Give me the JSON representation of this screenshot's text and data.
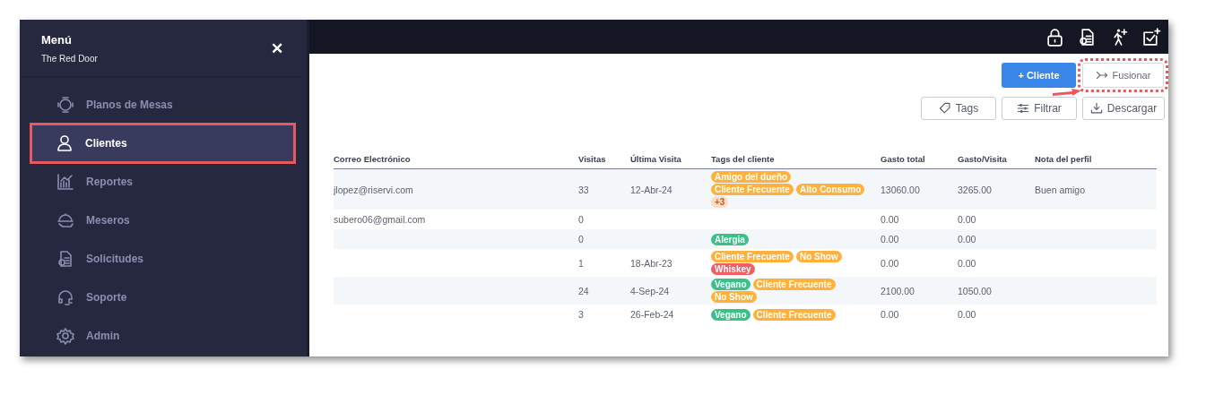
{
  "sidebar": {
    "title": "Menú",
    "subtitle": "The Red Door",
    "close_label": "✕",
    "items": [
      {
        "label": "Planos de Mesas",
        "kind": "table",
        "selected": false
      },
      {
        "label": "Clientes",
        "kind": "person",
        "selected": true
      },
      {
        "label": "Reportes",
        "kind": "chart",
        "selected": false
      },
      {
        "label": "Meseros",
        "kind": "waiter",
        "selected": false
      },
      {
        "label": "Solicitudes",
        "kind": "document",
        "selected": false
      },
      {
        "label": "Soporte",
        "kind": "headset",
        "selected": false
      },
      {
        "label": "Admin",
        "kind": "gear",
        "selected": false
      }
    ]
  },
  "topbar": {
    "icons": [
      {
        "kind": "lock"
      },
      {
        "kind": "document"
      },
      {
        "kind": "walker"
      },
      {
        "kind": "check"
      }
    ]
  },
  "actions": [
    {
      "label": "+ Cliente",
      "kind": "primary"
    },
    {
      "label": "Fusionar",
      "kind": "merge",
      "highlighted": true
    }
  ],
  "tools": [
    {
      "label": "Tags",
      "kind": "tag"
    },
    {
      "label": "Filtrar",
      "kind": "filter"
    },
    {
      "label": "Descargar",
      "kind": "download"
    }
  ],
  "table": {
    "columns": [
      "Correo Electrónico",
      "Visitas",
      "Última Visita",
      "Tags del cliente",
      "Gasto total",
      "Gasto/Visita",
      "Nota del perfil"
    ],
    "rows": [
      {
        "email": "jlopez@riservi.com",
        "visits": "33",
        "last": "12-Abr-24",
        "tags": [
          {
            "label": "Amigo del dueño",
            "color": "#ffb13b"
          },
          {
            "label": "Cliente Frecuente",
            "color": "#ffb13b"
          },
          {
            "label": "Alto Consumo",
            "color": "#ffb13b"
          }
        ],
        "more": "+3",
        "total": "13060.00",
        "per_visit": "3265.00",
        "note": "Buen amigo"
      },
      {
        "email": "subero06@gmail.com",
        "visits": "0",
        "total": "0.00",
        "per_visit": "0.00"
      },
      {
        "visits": "0",
        "tags": [
          {
            "label": "Alergia",
            "color": "#3cc08a"
          }
        ],
        "total": "0.00",
        "per_visit": "0.00"
      },
      {
        "visits": "1",
        "last": "18-Abr-23",
        "tags": [
          {
            "label": "Cliente Frecuente",
            "color": "#ffb13b"
          },
          {
            "label": "No Show",
            "color": "#ffb13b"
          },
          {
            "label": "Whiskey",
            "color": "#f25c63"
          }
        ],
        "total": "0.00",
        "per_visit": "0.00"
      },
      {
        "visits": "24",
        "last": "4-Sep-24",
        "tags": [
          {
            "label": "Vegano",
            "color": "#3cc08a"
          },
          {
            "label": "Cliente Frecuente",
            "color": "#ffb13b"
          },
          {
            "label": "No Show",
            "color": "#ffb13b"
          }
        ],
        "total": "2100.00",
        "per_visit": "1050.00"
      },
      {
        "visits": "3",
        "last": "26-Feb-24",
        "tags": [
          {
            "label": "Vegano",
            "color": "#3cc08a"
          },
          {
            "label": "Cliente Frecuente",
            "color": "#ffb13b"
          }
        ],
        "total": "0.00",
        "per_visit": "0.00"
      }
    ]
  }
}
